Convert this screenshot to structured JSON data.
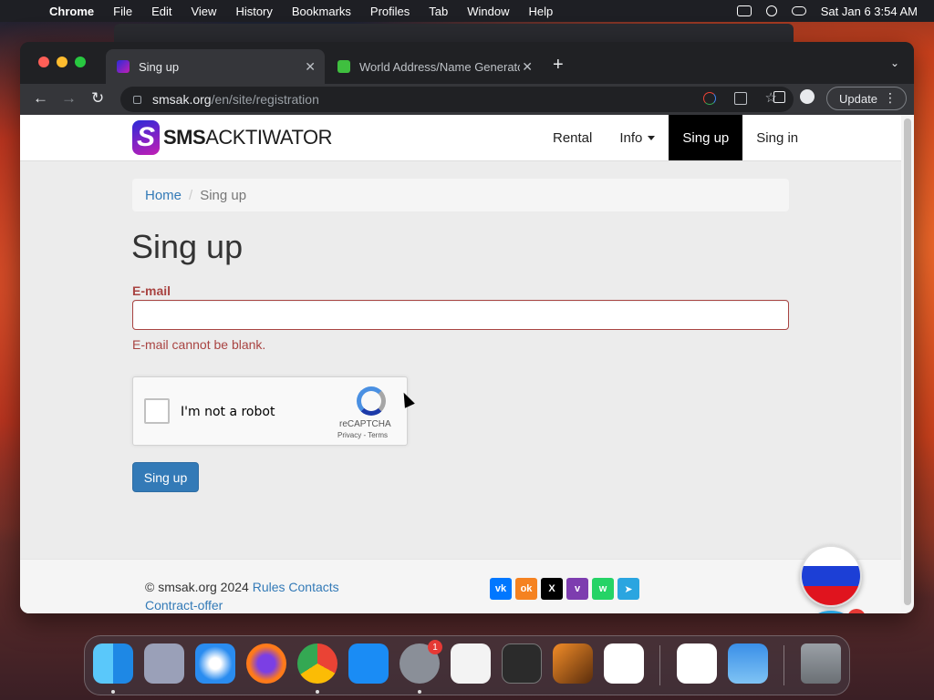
{
  "menubar": {
    "app_name": "Chrome",
    "items": [
      "File",
      "Edit",
      "View",
      "History",
      "Bookmarks",
      "Profiles",
      "Tab",
      "Window",
      "Help"
    ],
    "datetime": "Sat Jan 6  3:54 AM"
  },
  "browser": {
    "tabs": [
      {
        "title": "Sing up",
        "active": true
      },
      {
        "title": "World Address/Name Generato",
        "active": false
      }
    ],
    "url_host": "smsak.org",
    "url_path": "/en/site/registration",
    "update_label": "Update"
  },
  "site": {
    "logo_letter": "S",
    "logo_bold": "SMS",
    "logo_rest": "ACKTIWATOR",
    "nav": {
      "rental": "Rental",
      "info": "Info",
      "signup": "Sing up",
      "signin": "Sing in"
    },
    "breadcrumb": {
      "home": "Home",
      "separator": "/",
      "current": "Sing up"
    },
    "heading": "Sing up",
    "email_label": "E-mail",
    "email_value": "",
    "email_error": "E-mail cannot be blank.",
    "captcha": {
      "label": "I'm not a robot",
      "brand": "reCAPTCHA",
      "privacy": "Privacy",
      "dash": "-",
      "terms": "Terms",
      "checked": false
    },
    "submit_label": "Sing up",
    "footer": {
      "copyright": "© smsak.org 2024",
      "rules": "Rules",
      "contacts": "Contacts",
      "contract": "Contract-offer"
    },
    "social": [
      "vk-icon",
      "odnoklassniki-icon",
      "x-icon",
      "viber-icon",
      "whatsapp-icon",
      "telegram-icon"
    ],
    "telegram_badge": "1"
  },
  "dock": {
    "apps": [
      "finder-icon",
      "launchpad-icon",
      "safari-icon",
      "firefox-icon",
      "chrome-icon",
      "app-store-icon",
      "system-settings-icon",
      "textedit-icon",
      "terminal-icon",
      "garageband-icon",
      "vscode-icon",
      "visual-studio-icon",
      "weather-icon",
      "trash-icon"
    ],
    "settings_badge": "1"
  },
  "colors": {
    "error": "#a94442",
    "link": "#337ab7",
    "primary_button": "#337ab7",
    "nav_active_bg": "#000000"
  }
}
